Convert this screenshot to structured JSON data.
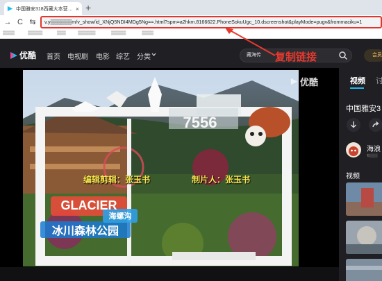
{
  "browser": {
    "tab_title": "中国雅安318西藏大本营-企",
    "tab_close": "×",
    "new_tab": "+",
    "back": "→",
    "reload": "C",
    "site_settings": "⇆",
    "url": "v.y▒▒▒▒▒▒m/v_show/id_XNjQ5NDI4MDg5Ng==.html?spm=a2hkm.8166622.PhoneSokuUgc_10.dscreenshot&playMode=pugv&frommaciku=1",
    "bookmarks": [
      "▒▒▒▒",
      "▒▒▒▒▒",
      "▒▒▒",
      "▒▒▒▒▒▒",
      "▒▒▒▒▒",
      "▒▒▒▒"
    ]
  },
  "site": {
    "logo": "优酷",
    "nav": [
      "首页",
      "电视剧",
      "电影",
      "综艺",
      "分类"
    ],
    "search_text": "藏海传",
    "vip_label": "会员"
  },
  "annotation": {
    "label": "复制链接",
    "color": "#e8392e"
  },
  "player": {
    "watermark": "优酷",
    "credit_editor": "编辑剪辑：张玉书",
    "credit_producer": "制片人：张玉书",
    "scene_text": {
      "sign_number": "7556",
      "glacier_en": "GLACIER",
      "park_cn": "冰川森林公园",
      "hailuogou": "海螺沟"
    }
  },
  "sidebar": {
    "tabs": [
      "视频",
      "讨"
    ],
    "title": "中国雅安3",
    "uploader": "海浪",
    "uploader_sub": "有▒▒▒",
    "section": "视频"
  },
  "colors": {
    "accent": "#1ebbf0",
    "highlight": "#e0362d",
    "credit": "#f6e44d"
  }
}
